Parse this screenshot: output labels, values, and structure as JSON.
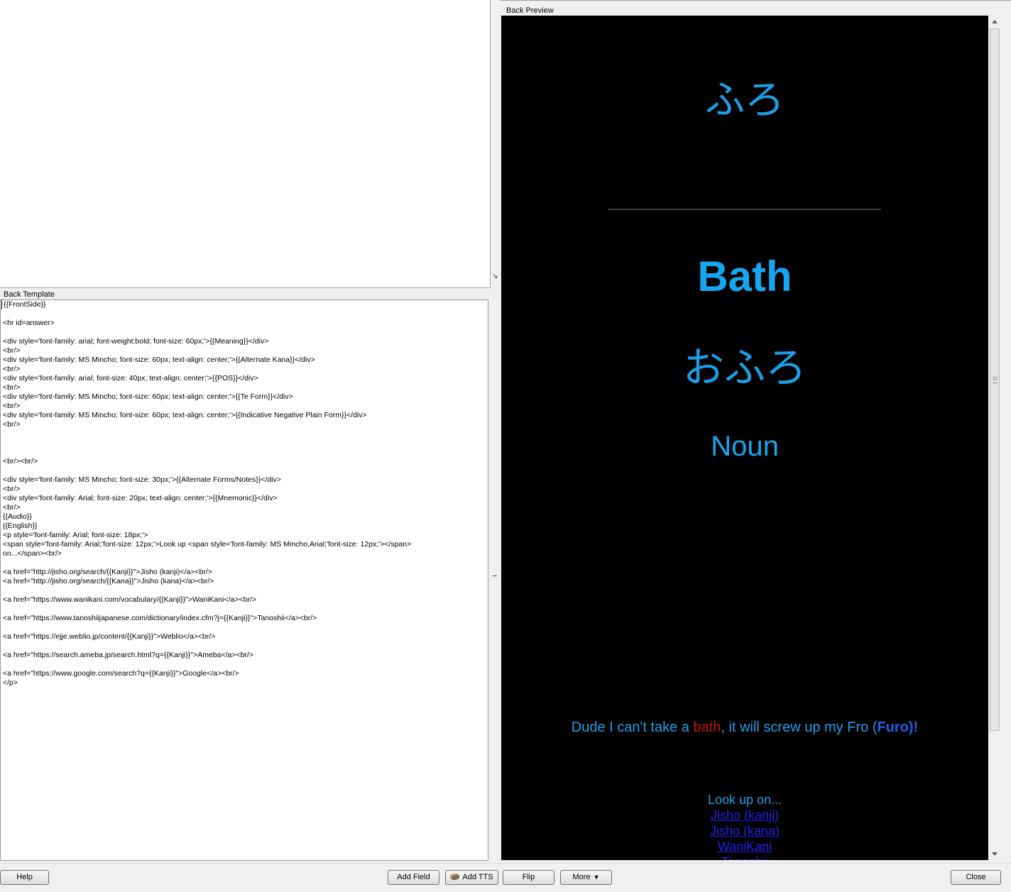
{
  "front_template": {
    "content": ""
  },
  "back_template": {
    "label": "Back Template",
    "lines": [
      "{{FrontSide}}",
      "",
      "<hr id=answer>",
      "",
      "<div style='font-family: arial; font-weight:bold; font-size: 60px;'>{{Meaning}}</div>",
      "<br/>",
      "<div style='font-family: MS Mincho; font-size: 60px; text-align: center;'>{{Alternate Kana}}</div>",
      "<br/>",
      "<div style='font-family: arial; font-size: 40px; text-align: center;'>{{POS}}</div>",
      "<br/>",
      "<div style='font-family: MS Mincho; font-size: 60px; text-align: center;'>{{Te Form}}</div>",
      "<br/>",
      "<div style='font-family: MS Mincho; font-size: 60px; text-align: center;'>{{Indicative Negative Plain Form}}</div>",
      "<br/>",
      "",
      "",
      "",
      "<br/><br/>",
      "",
      "<div style='font-family: MS Mincho; font-size: 30px;'>{{Alternate Forms/Notes}}</div>",
      "<br/>",
      "<div style='font-family: Arial; font-size: 20px; text-align: center;'>{{Mnemonic}}</div>",
      "<br/>",
      "{{Audio}}",
      "{{English}}",
      "<p style='font-family: Arial; font-size: 18px;'>",
      "<span style='font-family: Arial;'font-size: 12px;'>Look up <span style='font-family: MS Mincho,Arial;'font-size: 12px;'></span>",
      "on...</span><br/>",
      "",
      "<a href=\"http://jisho.org/search/{{Kanji}}\">Jisho (kanji)</a><br/>",
      "<a href=\"http://jisho.org/search/{{Kana}}\">Jisho (kana)</a><br/>",
      "",
      "<a href=\"https://www.wanikani.com/vocabulary/{{Kanji}}\">WaniKani</a><br/>",
      "",
      "<a href=\"https://www.tanoshiijapanese.com/dictionary/index.cfm?j={{Kanji}}\">Tanoshii</a><br/>",
      "",
      "<a href=\"https://ejje.weblio.jp/content/{{Kanji}}\">Weblio</a><br/>",
      "",
      "<a href=\"https://search.ameba.jp/search.html?q={{Kanji}}\">Ameba</a><br/>",
      "",
      "<a href=\"https://www.google.com/search?q={{Kanji}}\">Google</a><br/>",
      "</p>"
    ]
  },
  "splitter": {
    "arrow": "→",
    "grip": "↘"
  },
  "back_preview": {
    "label": "Back Preview",
    "kana": "ふろ",
    "meaning": "Bath",
    "alternate_kana": "おふろ",
    "pos": "Noun",
    "mnemonic": {
      "part1": "Dude I can't take a ",
      "highlight_red": "bath",
      "part2": ", it will screw up my Fro (",
      "highlight_blue": "Furo)!"
    },
    "lookup_label": "Look up on...",
    "links": [
      "Jisho (kanji)",
      "Jisho (kana)",
      "WaniKani",
      "Tanoshii"
    ]
  },
  "buttons": {
    "help": "Help",
    "add_field": "Add Field",
    "add_tts": "Add TTS",
    "flip": "Flip",
    "more": "More",
    "more_caret": "▼",
    "close": "Close"
  },
  "colors": {
    "preview_bg": "#000000",
    "preview_text": "#1a9fe6",
    "link": "#2020e8",
    "mnemonic_red": "#c0150f",
    "mnemonic_blue": "#1f5fe8"
  }
}
